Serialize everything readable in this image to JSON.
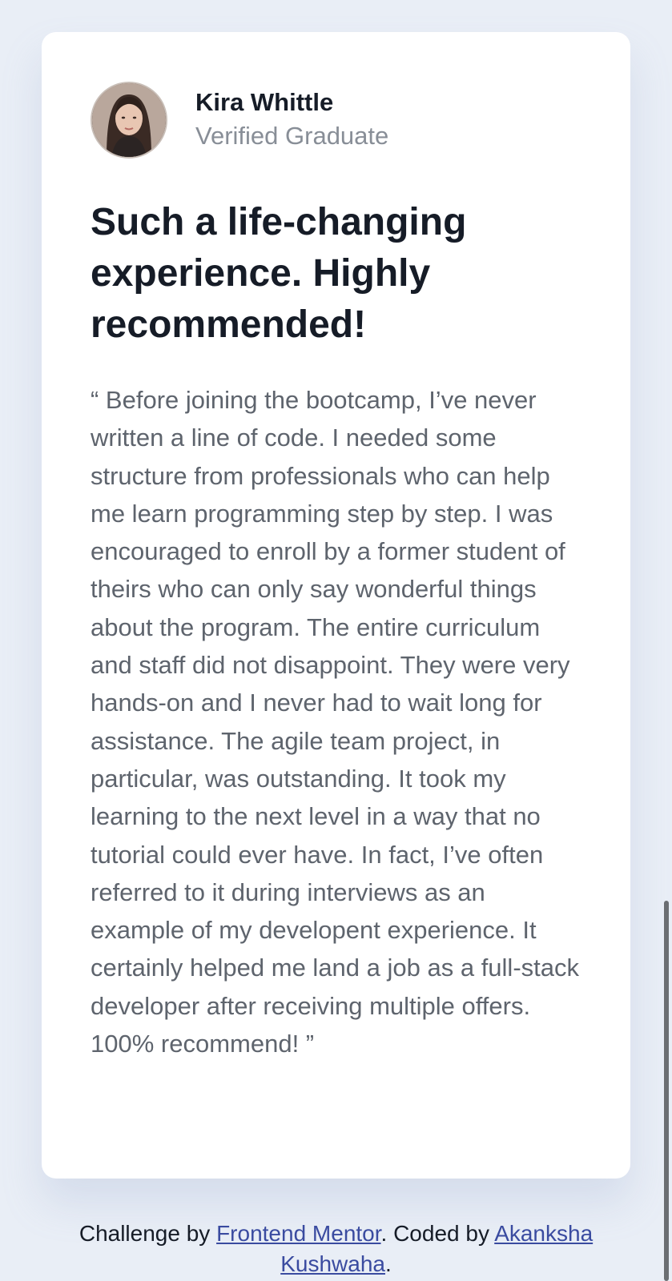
{
  "testimonial": {
    "name": "Kira Whittle",
    "role": "Verified Graduate",
    "headline": "Such a life-changing experience. Highly recommended!",
    "quote": "“ Before joining the bootcamp, I’ve never written a line of code. I needed some structure from professionals who can help me learn programming step by step. I was encouraged to enroll by a former student of theirs who can only say wonderful things about the program. The entire curriculum and staff did not disappoint. They were very hands-on and I never had to wait long for assistance. The agile team project, in particular, was outstanding. It took my learning to the next level in a way that no tutorial could ever have. In fact, I’ve often referred to it during interviews as an example of my developent experience. It certainly helped me land a job as a full-stack developer after receiving multiple offers. 100% recommend! ”",
    "avatar_icon": "avatar-photo"
  },
  "footer": {
    "prefix": "Challenge by ",
    "link1": "Frontend Mentor",
    "middle": ". Coded by ",
    "link2": "Akanksha Kushwaha",
    "suffix": "."
  },
  "colors": {
    "background": "#e9eef6",
    "card": "#ffffff",
    "heading": "#161c27",
    "muted": "#888e97",
    "body_text": "#5e646d",
    "link": "#3a4ba0"
  }
}
